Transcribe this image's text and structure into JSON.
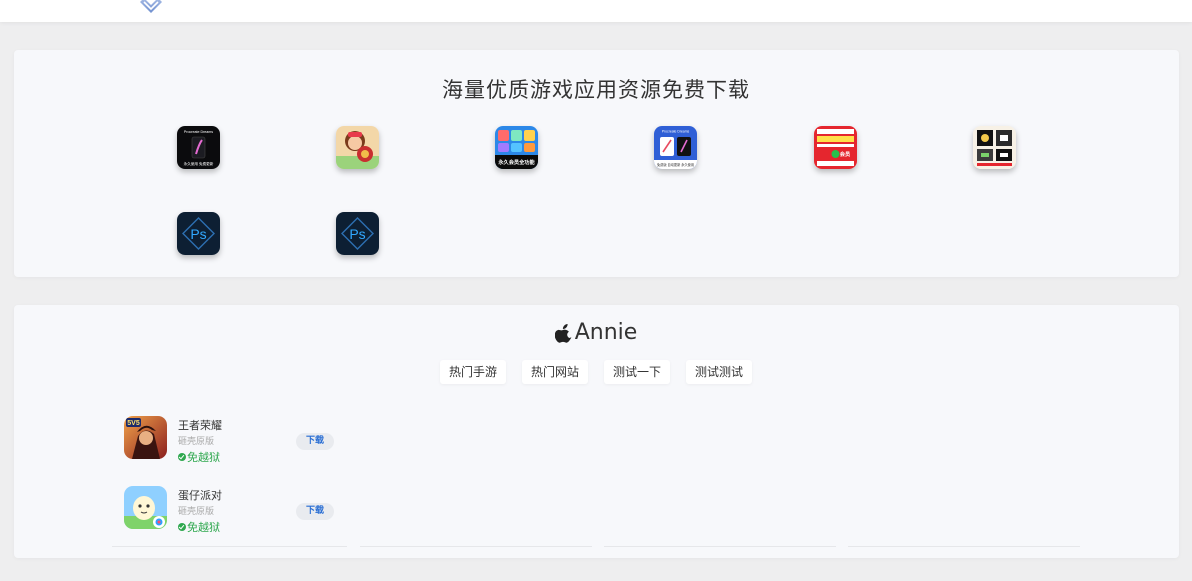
{
  "resources": {
    "title": "海量优质游戏应用资源免费下载",
    "apps": [
      {
        "icon": "procreate-dreams-icon",
        "caption_top": "Procreate Dreams",
        "caption_bottom": "永久使用 免费更新"
      },
      {
        "icon": "cooking-mama-icon"
      },
      {
        "icon": "game-bundle-icon",
        "caption_bottom": "永久会员全功能"
      },
      {
        "icon": "procreate-dreams-blue-icon",
        "caption_top": "Procreate Dreams",
        "caption_bottom": "免费版 自动更新 永久使用"
      },
      {
        "icon": "red-promo-icon",
        "caption_bottom": "会员"
      },
      {
        "icon": "dark-grid-app-icon"
      },
      {
        "icon": "photoshop-icon",
        "label": "Ps"
      },
      {
        "icon": "photoshop-icon",
        "label": "Ps"
      }
    ]
  },
  "store": {
    "brand": "Annie",
    "tabs": [
      "热门手游",
      "热门网站",
      "测试一下",
      "测试测试"
    ],
    "games": [
      {
        "name": "王者荣耀",
        "sub": "砸壳原版",
        "tag": "免越狱",
        "download": "下载",
        "icon": "honor-of-kings-icon"
      },
      {
        "name": "蛋仔派对",
        "sub": "砸壳原版",
        "tag": "免越狱",
        "download": "下载",
        "icon": "eggy-party-icon"
      }
    ]
  },
  "colors": {
    "accent": "#2b6fd4",
    "success": "#2fa84f",
    "card": "#f7f8fb",
    "background": "#eeeeef"
  }
}
